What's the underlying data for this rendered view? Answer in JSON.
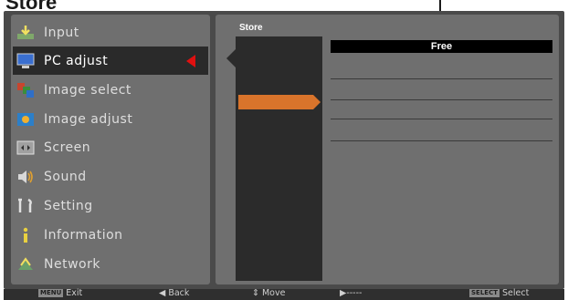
{
  "page": {
    "heading": "Store"
  },
  "menu": {
    "items": [
      {
        "label": "Input",
        "icon": "input-icon"
      },
      {
        "label": "PC adjust",
        "icon": "pc-adjust-icon",
        "selected": true
      },
      {
        "label": "Image select",
        "icon": "image-select-icon"
      },
      {
        "label": "Image adjust",
        "icon": "image-adjust-icon"
      },
      {
        "label": "Screen",
        "icon": "screen-icon"
      },
      {
        "label": "Sound",
        "icon": "sound-icon"
      },
      {
        "label": "Setting",
        "icon": "setting-icon"
      },
      {
        "label": "Information",
        "icon": "information-icon"
      },
      {
        "label": "Network",
        "icon": "network-icon"
      }
    ]
  },
  "store": {
    "title": "Store",
    "slots": [
      "Free",
      "",
      "",
      "",
      ""
    ]
  },
  "status": {
    "exit_key": "MENU",
    "exit": "Exit",
    "back": "Back",
    "move": "Move",
    "dashes": "-----",
    "select_key": "SELECT",
    "select": "Select"
  },
  "colors": {
    "accent_orange": "#d9742b",
    "selected_arrow": "#e01010"
  }
}
